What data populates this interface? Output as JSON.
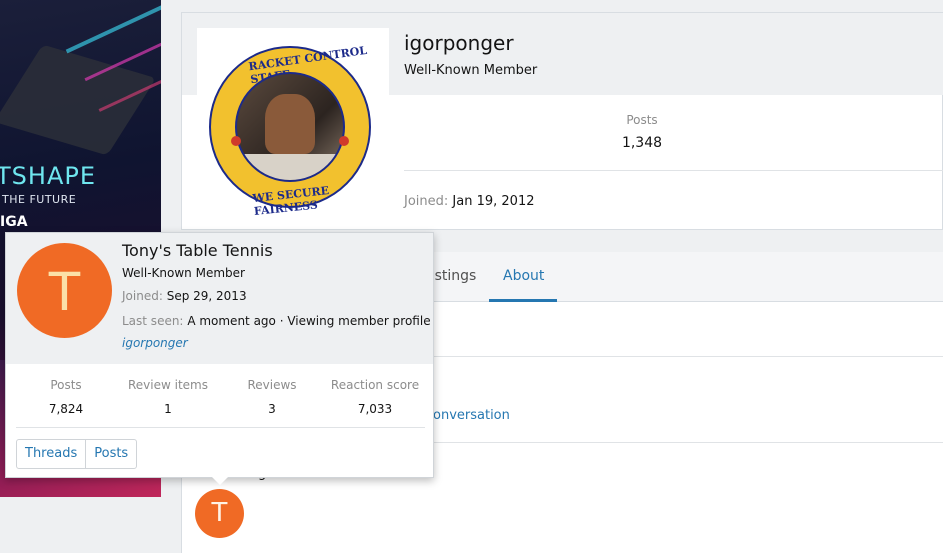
{
  "ad": {
    "brand": "TSHAPE",
    "tagline": "THE FUTURE",
    "logo": "IGA"
  },
  "member": {
    "username": "igorponger",
    "title": "Well-Known Member",
    "posts_label": "Posts",
    "posts_value": "1,348",
    "joined_label": "Joined:",
    "joined_value": "Jan 19, 2012",
    "badge_top_text": "RACKET CONTROL STAFF",
    "badge_bottom_text": "WE SECURE FAIRNESS"
  },
  "tabs": {
    "postings": "ostings",
    "about": "About"
  },
  "content": {
    "conversation_link": "onversation",
    "follower_initial": "T",
    "fragment": "g"
  },
  "tooltip": {
    "initial": "T",
    "name": "Tony's Table Tennis",
    "title": "Well-Known Member",
    "joined_label": "Joined:",
    "joined_value": "Sep 29, 2013",
    "last_seen_label": "Last seen:",
    "last_seen_value": "A moment ago · Viewing member profile",
    "profile_link": "igorponger",
    "stats": [
      {
        "label": "Posts",
        "value": "7,824"
      },
      {
        "label": "Review items",
        "value": "1"
      },
      {
        "label": "Reviews",
        "value": "3"
      },
      {
        "label": "Reaction score",
        "value": "7,033"
      }
    ],
    "buttons": {
      "threads": "Threads",
      "posts": "Posts"
    }
  }
}
